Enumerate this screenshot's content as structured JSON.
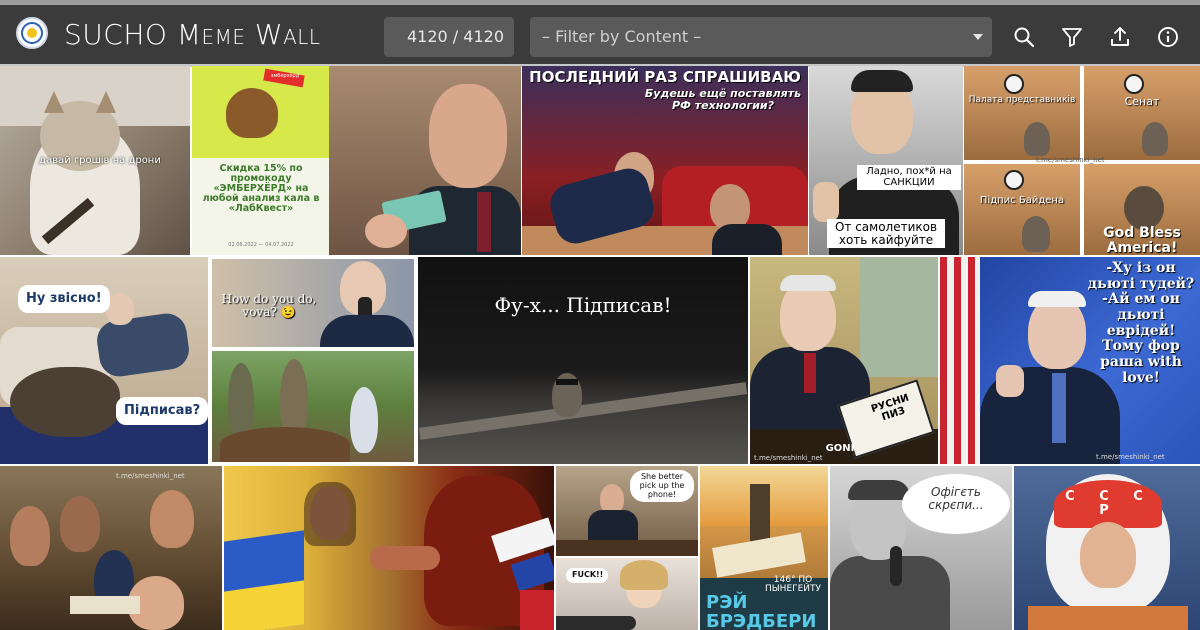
{
  "header": {
    "title": "SUCHO Meme Wall",
    "counter": "4120 / 4120",
    "filter_placeholder": "– Filter by Content –",
    "icons": [
      "search-icon",
      "filter-icon",
      "upload-icon",
      "info-icon"
    ]
  },
  "tiles": {
    "cat_drone": {
      "caption": "давай грошів на дрони"
    },
    "lab_ad": {
      "badge": "эмберхёрд",
      "text": "Скидка 15% по промокоду «ЭМБЕРХЁРД» на любой анализ кала в «ЛабКвест»",
      "fine": "02.06.2022 — 04.07.2022"
    },
    "blinken": {
      "line1": "ПОСЛЕДНИЙ РАЗ СПРАШИВАЮ",
      "line2": "Будешь ещё поставлять РФ технологии?"
    },
    "trudeau": {
      "top": "Ладно, пох*й на САНКЦИИ",
      "bottom": "От самолетиков хоть кайфуйте"
    },
    "cats": {
      "q1": "Палата представників",
      "q2": "Сенат",
      "q3": "Підпис Байдена",
      "q4": "God Bless America!",
      "watermark": "t.me/smeshinki_net"
    },
    "biden_dog": {
      "bubble1": "Ну звісно!",
      "bubble2": "Підписав?"
    },
    "phone": {
      "caption": "How do you do, vova? 😉"
    },
    "raccoon": {
      "caption": "Фу-х... Підписав!"
    },
    "signing": {
      "book": "РУСНИ ПИЗ",
      "brand": "GONI",
      "watermark": "t.me/smeshinki_net"
    },
    "biden_flag": {
      "text": "-Ху із он дьюті тудей?\n-Ай ем он дьюті еврідей!\nТому фор раша with love!",
      "watermark": "t.me/smeshinki_net"
    },
    "cossacks": {
      "watermark": "t.me/smeshinki_net"
    },
    "putin_phone": {
      "bubble1": "She better pick up the phone!",
      "bubble2": "FUCK!!"
    },
    "book": {
      "line1": "146° ПО ПЫНЕГЕЙТУ",
      "line2": "РЭЙ БРЭДБЕРИ"
    },
    "korolev": {
      "bubble": "Офігєть скрєпи..."
    },
    "gagarin": {
      "letters": "С С С Р"
    }
  },
  "colors": {
    "topbar": "#3b3b3b",
    "input_bg": "#5a5a5a",
    "accent_blue": "#2e62b3",
    "accent_yellow": "#f3c21b"
  }
}
